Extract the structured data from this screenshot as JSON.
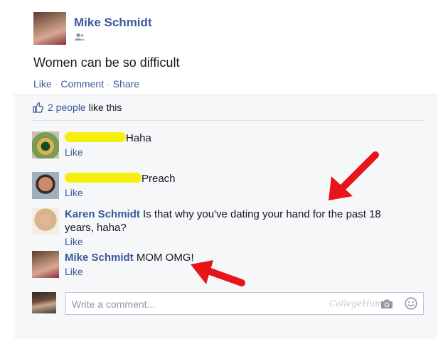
{
  "post": {
    "author": "Mike Schmidt",
    "text": "Women can be so difficult",
    "actions": {
      "like": "Like",
      "comment": "Comment",
      "share": "Share",
      "separator": "·"
    }
  },
  "likes": {
    "count_text": "2 people",
    "suffix": "like this"
  },
  "comments": [
    {
      "name": "",
      "text": "Haha",
      "like_label": "Like",
      "redacted": true,
      "avatar_icon": "sunflower-avatar"
    },
    {
      "name": "",
      "text": "Preach",
      "like_label": "Like",
      "redacted": true,
      "avatar_icon": "man-avatar"
    },
    {
      "name": "Karen Schmidt",
      "text": "Is that why you've dating your hand for the past 18 years, haha?",
      "like_label": "Like",
      "redacted": false,
      "avatar_icon": "woman-avatar"
    },
    {
      "name": "Mike Schmidt",
      "text": "MOM OMG!",
      "like_label": "Like",
      "redacted": false,
      "avatar_icon": "mike-avatar"
    }
  ],
  "composer": {
    "placeholder": "Write a comment...",
    "watermark": "CollegeHumor"
  },
  "colors": {
    "link": "#3b5998",
    "redaction": "#f5ef0b",
    "arrow": "#e8141b",
    "ufi_bg": "#f6f7f9"
  }
}
